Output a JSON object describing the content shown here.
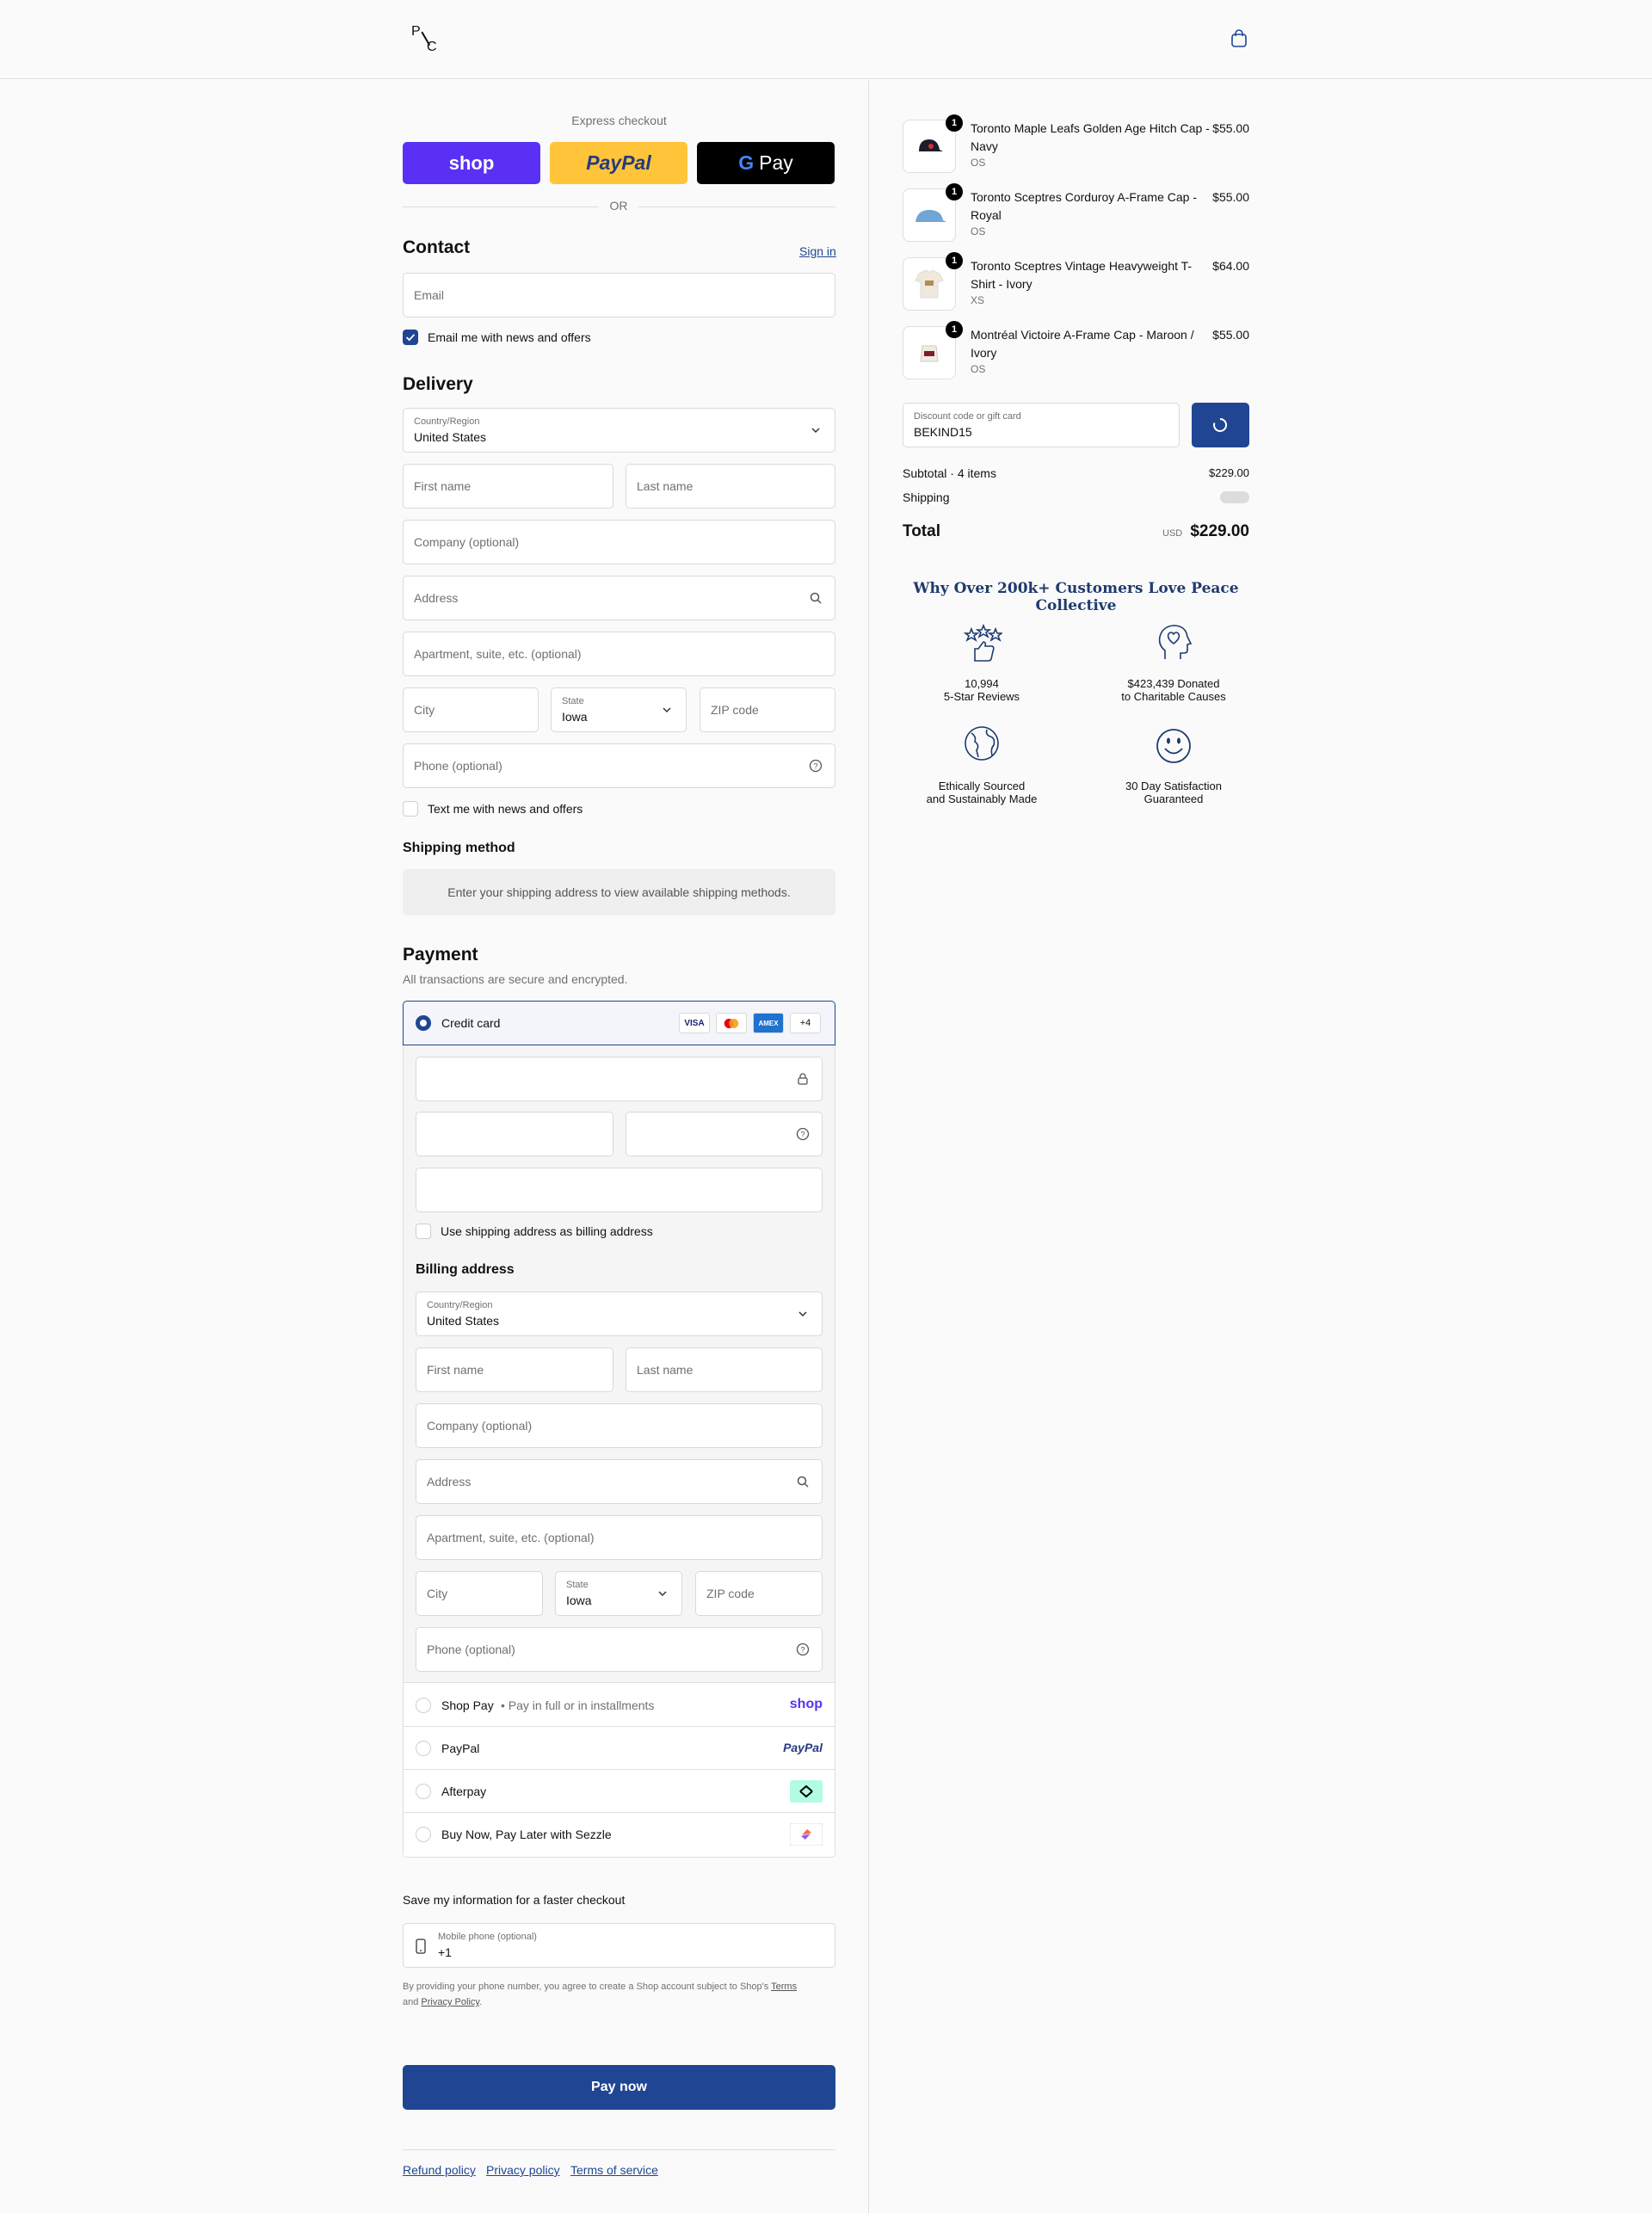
{
  "header": {
    "logo_p": "P",
    "logo_c": "C"
  },
  "express": {
    "label": "Express checkout",
    "shop_label": "shop",
    "paypal_label": "PayPal",
    "gpay_label": "Pay",
    "gpay_g": "G",
    "or_label": "OR"
  },
  "contact": {
    "title": "Contact",
    "sign_in": "Sign in",
    "email_placeholder": "Email",
    "news_label": "Email me with news and offers",
    "news_checked": true
  },
  "delivery": {
    "title": "Delivery",
    "country_label": "Country/Region",
    "country_value": "United States",
    "first_name": "First name",
    "last_name": "Last name",
    "company": "Company (optional)",
    "address": "Address",
    "apartment": "Apartment, suite, etc. (optional)",
    "city": "City",
    "state_label": "State",
    "state_value": "Iowa",
    "zip": "ZIP code",
    "phone": "Phone (optional)",
    "sms_label": "Text me with news and offers"
  },
  "shipping_method": {
    "title": "Shipping method",
    "message": "Enter your shipping address to view available shipping methods."
  },
  "payment": {
    "title": "Payment",
    "subtitle": "All transactions are secure and encrypted.",
    "credit_card_label": "Credit card",
    "card_badges": [
      "VISA",
      "MC",
      "AMEX",
      "+4"
    ],
    "use_shipping_label": "Use shipping address as billing address",
    "billing_title": "Billing address",
    "billing": {
      "country_label": "Country/Region",
      "country_value": "United States",
      "first_name": "First name",
      "last_name": "Last name",
      "company": "Company (optional)",
      "address": "Address",
      "apartment": "Apartment, suite, etc. (optional)",
      "city": "City",
      "state_label": "State",
      "state_value": "Iowa",
      "zip": "ZIP code",
      "phone": "Phone (optional)"
    },
    "alternatives": [
      {
        "label": "Shop Pay",
        "sub": "Pay in full or in installments",
        "logo": "shop"
      },
      {
        "label": "PayPal",
        "logo": "PayPal"
      },
      {
        "label": "Afterpay",
        "logo": "afterpay-icon"
      },
      {
        "label": "Buy Now, Pay Later with Sezzle",
        "logo": "sezzle-icon"
      }
    ]
  },
  "save_info": {
    "title": "Save my information for a faster checkout",
    "mobile_label": "Mobile phone (optional)",
    "mobile_value": "+1",
    "legal_prefix": "By providing your phone number, you agree to create a Shop account subject to Shop's",
    "terms": "Terms",
    "and": "and",
    "privacy": "Privacy Policy",
    "period": "."
  },
  "pay_now": "Pay now",
  "footer": [
    "Refund policy",
    "Privacy policy",
    "Terms of service"
  ],
  "order": {
    "items": [
      {
        "name": "Toronto Maple Leafs Golden Age Hitch Cap - Navy",
        "variant": "OS",
        "price": "$55.00",
        "qty": "1"
      },
      {
        "name": "Toronto Sceptres Corduroy A-Frame Cap - Royal",
        "variant": "OS",
        "price": "$55.00",
        "qty": "1"
      },
      {
        "name": "Toronto Sceptres Vintage Heavyweight T-Shirt - Ivory",
        "variant": "XS",
        "price": "$64.00",
        "qty": "1"
      },
      {
        "name": "Montréal Victoire A-Frame Cap - Maroon / Ivory",
        "variant": "OS",
        "price": "$55.00",
        "qty": "1"
      }
    ],
    "discount_label": "Discount code or gift card",
    "discount_value": "BEKIND15",
    "subtotal_label": "Subtotal · 4 items",
    "subtotal_value": "$229.00",
    "shipping_label": "Shipping",
    "total_label": "Total",
    "currency": "USD",
    "total_value": "$229.00"
  },
  "why": {
    "title": "Why Over 200k+ Customers Love Peace Collective",
    "stats": [
      {
        "line1": "10,994",
        "line2": "5-Star Reviews",
        "icon": "stars-thumb-icon"
      },
      {
        "line1": "$423,439 Donated",
        "line2": "to Charitable Causes",
        "icon": "head-heart-icon"
      },
      {
        "line1": "Ethically Sourced",
        "line2": "and Sustainably Made",
        "icon": "globe-icon"
      },
      {
        "line1": "30 Day Satisfaction",
        "line2": "Guaranteed",
        "icon": "smiley-icon"
      }
    ]
  },
  "colors": {
    "accent": "#1f4593",
    "shop": "#5a31f4",
    "paypal": "#ffc439"
  }
}
